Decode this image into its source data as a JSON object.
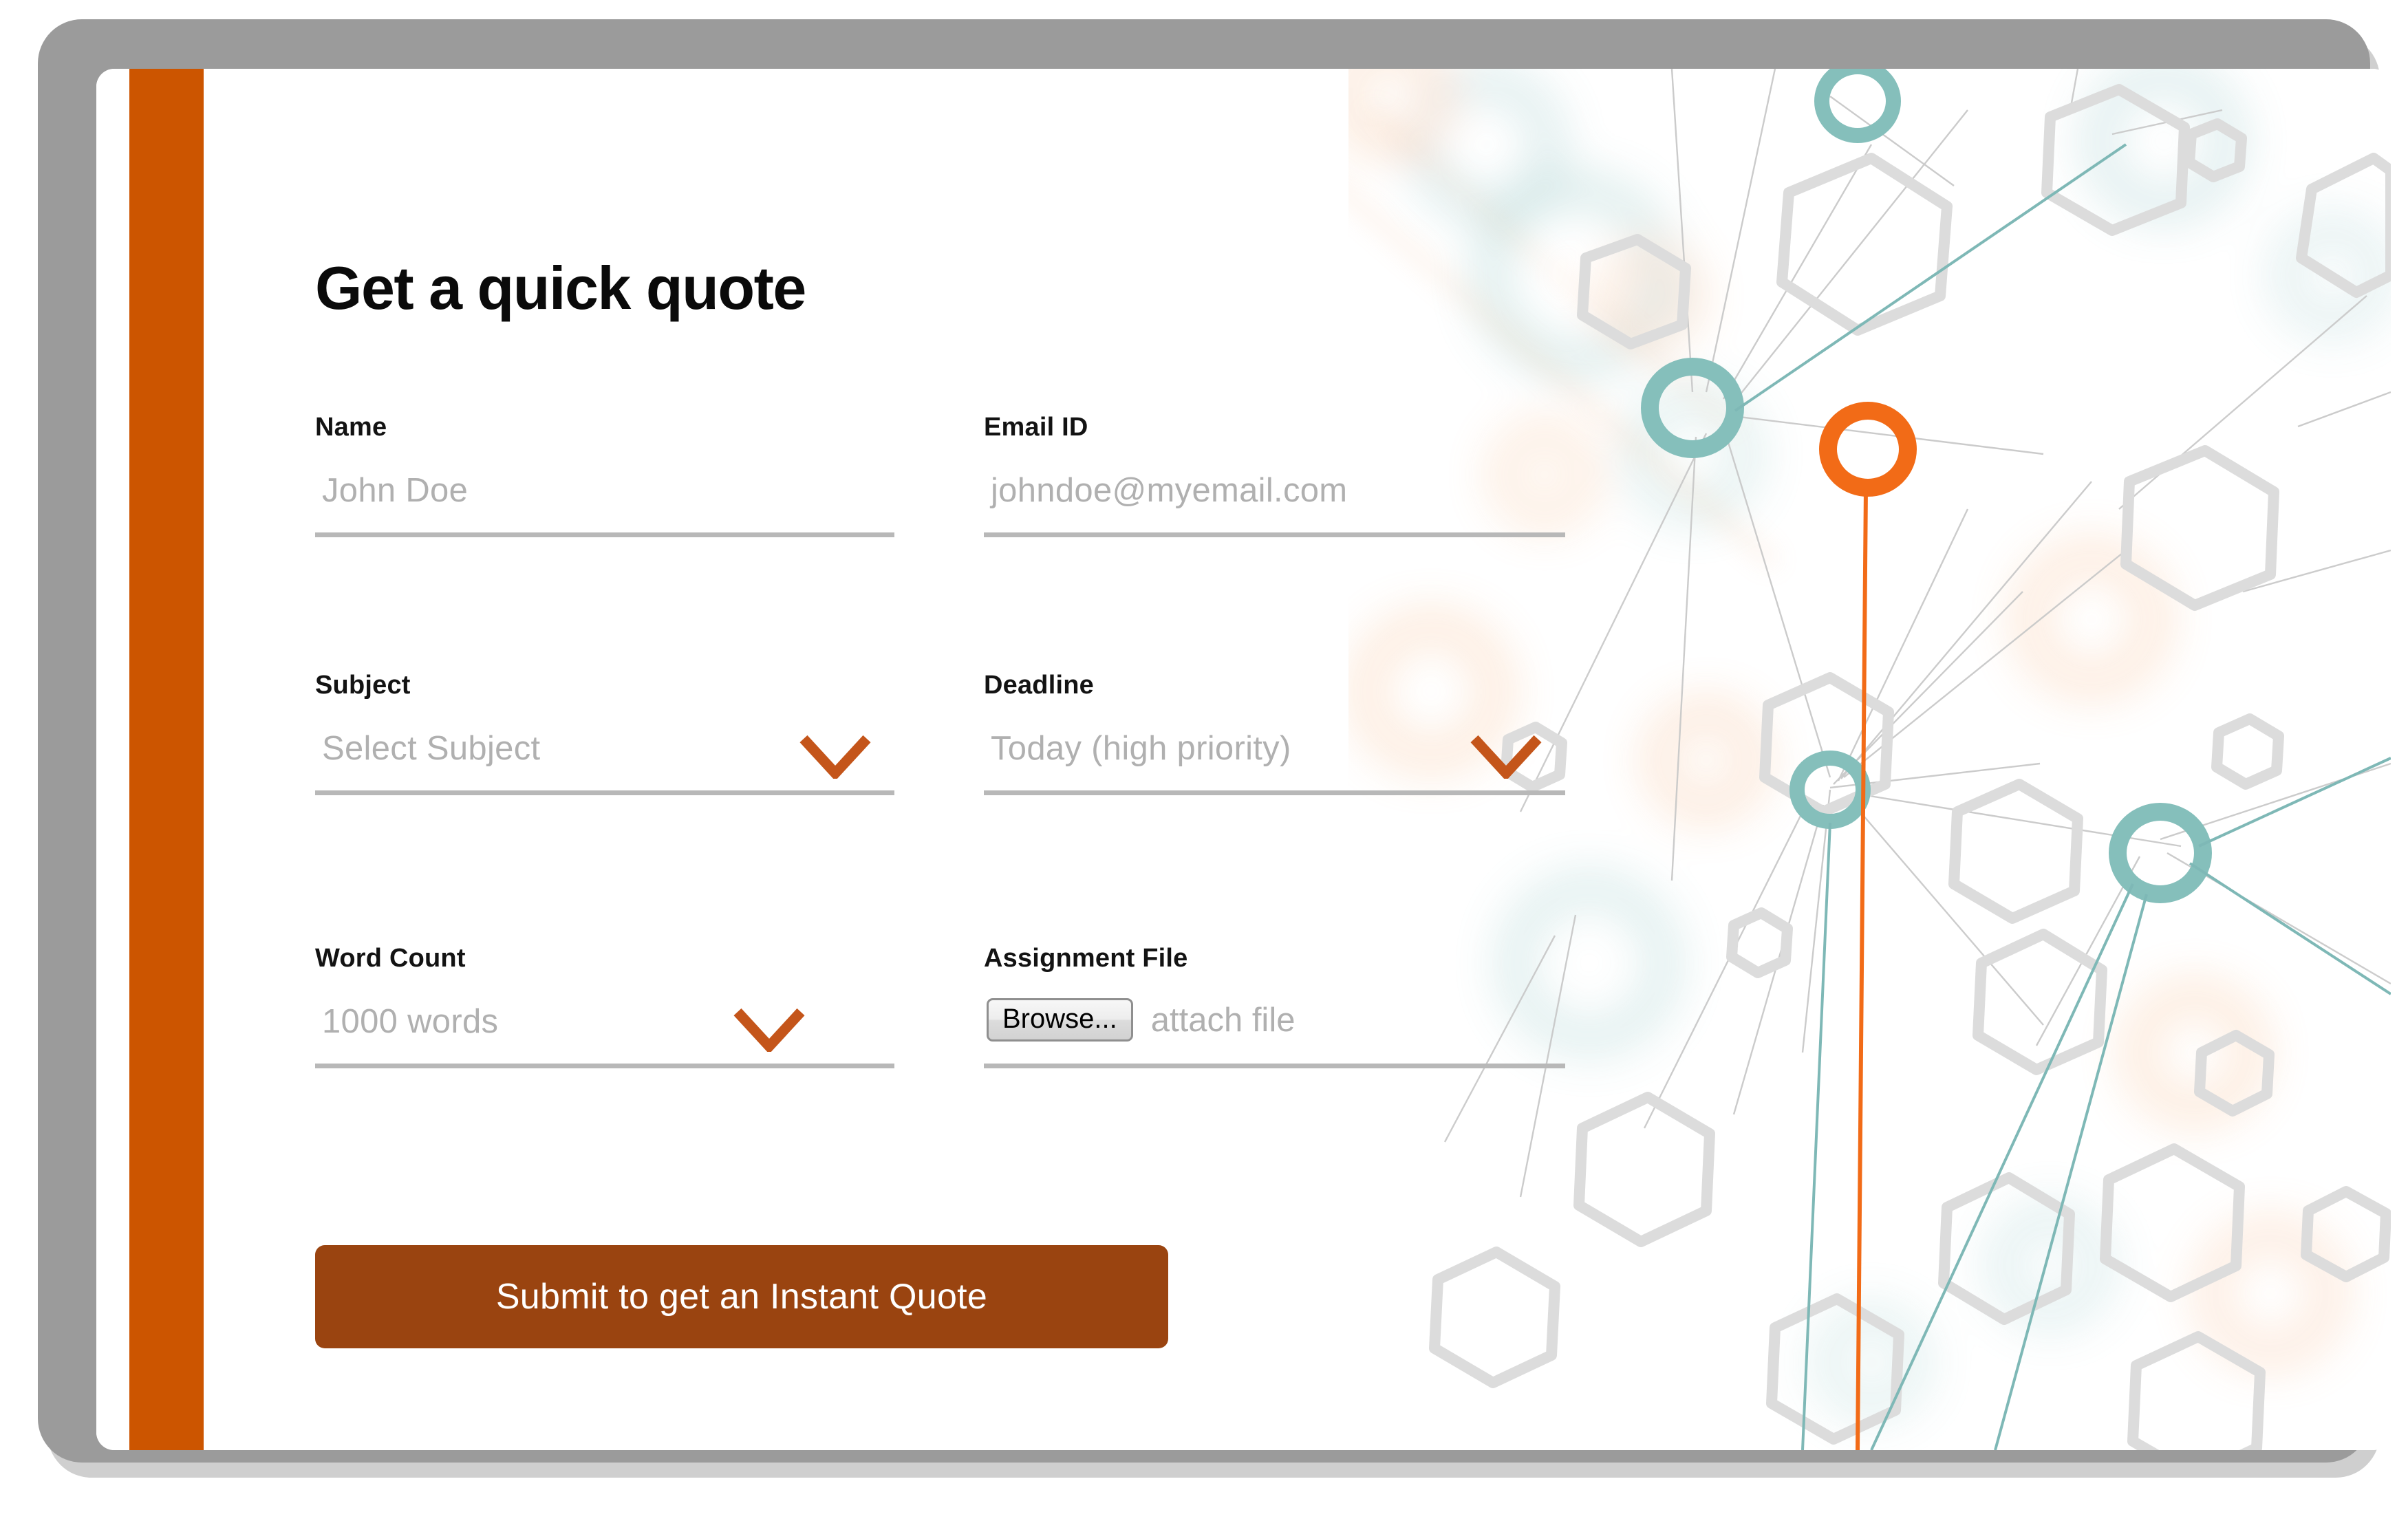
{
  "card": {
    "title": "Get a quick quote",
    "accent_color": "#cc5500",
    "chevron_color": "#c4551a",
    "submit_color": "#9a4410",
    "underline_color": "#b8b8b8",
    "bezel_color": "#9b9b9b"
  },
  "fields": {
    "name": {
      "label": "Name",
      "placeholder": "John Doe",
      "value": ""
    },
    "email": {
      "label": "Email ID",
      "placeholder": "johndoe@myemail.com",
      "value": ""
    },
    "subject": {
      "label": "Subject",
      "placeholder": "Select Subject",
      "value": "",
      "icon": "chevron-down-icon"
    },
    "deadline": {
      "label": "Deadline",
      "placeholder": "Today (high priority)",
      "value": "",
      "icon": "chevron-down-icon"
    },
    "word_count": {
      "label": "Word Count",
      "placeholder": "1000 words",
      "value": "",
      "icon": "chevron-down-icon"
    },
    "assignment_file": {
      "label": "Assignment File",
      "browse_label": "Browse...",
      "file_name": "attach file",
      "value": ""
    }
  },
  "submit": {
    "label": "Submit to get an Instant Quote"
  },
  "background_art": {
    "name": "molecular-network-graphic",
    "teal_node_color": "#85bfbb",
    "orange_node_color": "#f26b17",
    "hexagon_color": "#dcdcdc",
    "line_color": "#c9c9c9"
  }
}
